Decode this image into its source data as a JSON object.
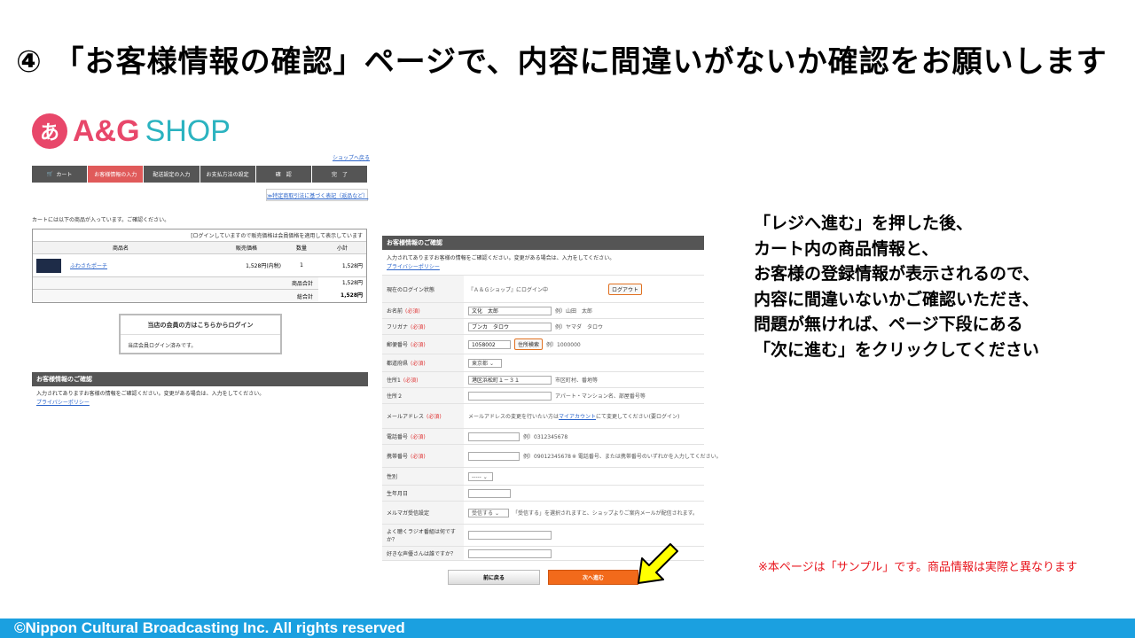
{
  "title": "④ 「お客様情報の確認」ページで、内容に間違いがないか確認をお願いします",
  "logo": {
    "mark": "あ",
    "ag": "A&G",
    "shop": "SHOP"
  },
  "shop_back_link": "ショップへ戻る",
  "steps": [
    "カート",
    "お客様情報の入力",
    "配送設定の入力",
    "お支払方法の設定",
    "確　認",
    "完　了"
  ],
  "tokutei_link": "≫特定商取引法に基づく表記（返品など）",
  "cart": {
    "intro": "カートには以下の商品が入っています。ご確認ください。",
    "notice": "[ログインしていますので販売価格は会員価格を適用して表示しています",
    "headers": [
      "商品名",
      "販売価格",
      "数量",
      "小計"
    ],
    "item": {
      "name": "ふわさたポーチ",
      "price": "1,528円(内税)",
      "qty": "1",
      "subtotal": "1,528円"
    },
    "goods_total_label": "商品合計",
    "goods_total": "1,528円",
    "grand_total_label": "総合計",
    "grand_total": "1,528円"
  },
  "member_box": {
    "title": "当店の会員の方はこちらからログイン",
    "status": "当店会員ログイン済みです。"
  },
  "left_confirm": {
    "heading": "お客様情報のご確認",
    "desc": "入力されてありますお客様の情報をご確認ください。変更がある場合は、入力をしてください。",
    "privacy": "プライバシーポリシー"
  },
  "form": {
    "heading": "お客様情報のご確認",
    "desc": "入力されてありますお客様の情報をご確認ください。変更がある場合は、入力をしてください。",
    "privacy": "プライバシーポリシー",
    "required_label": "(必須)",
    "login_state_label": "現在のログイン状態",
    "login_state_text": "『Ａ＆Ｇショップ』にログイン中",
    "logout_button": "ログアウト",
    "name_label": "お名前",
    "name_value": "文化　太郎",
    "name_example": "例）山田　太郎",
    "kana_label": "フリガナ",
    "kana_value": "ブンカ　タロウ",
    "kana_example": "例）ヤマダ　タロウ",
    "zip_label": "郵便番号",
    "zip_value": "1058002",
    "zip_button": "住所検索",
    "zip_example": "例）1000000",
    "pref_label": "都道府県",
    "pref_value": "東京都",
    "addr1_label": "住所1",
    "addr1_value": "港区浜松町１－３１",
    "addr1_hint": "市区町村、番地等",
    "addr2_label": "住所２",
    "addr2_hint": "アパート・マンション名、部屋番号等",
    "mail_label": "メールアドレス",
    "mail_text_pre": "メールアドレスの変更を行いたい方は",
    "mail_link": "マイアカウント",
    "mail_text_post": "にて変更してください(要ログイン)",
    "tel_label": "電話番号",
    "tel_example": "例）0312345678",
    "mobile_label": "携帯番号",
    "mobile_example": "例）09012345678",
    "mobile_note": "※ 電話番号、または携帯番号のいずれかを入力してください。",
    "gender_label": "性別",
    "gender_value": "-----",
    "birthday_label": "生年月日",
    "magazine_label": "メルマガ受信設定",
    "magazine_value": "受信する",
    "magazine_note": "「受信する」を選択されますと、ショップよりご案内メールが配信されます。",
    "radio_label": "よく聴くラジオ番組は何ですか？",
    "seiyu_label": "好きな声優さんは誰ですか？"
  },
  "buttons": {
    "back": "前に戻る",
    "next": "次へ進む"
  },
  "instructions": [
    "「レジへ進む」を押した後、",
    "カート内の商品情報と、",
    "お客様の登録情報が表示されるので、",
    "内容に間違いないかご確認いただき、",
    "問題が無ければ、ページ下段にある",
    "「次に進む」をクリックしてください"
  ],
  "sample_note": "※本ページは「サンプル」です。商品情報は実際と異なります",
  "footer": "©Nippon Cultural Broadcasting Inc. All rights reserved",
  "colors": {
    "accent_red": "#e8476a",
    "accent_teal": "#2bb3c0",
    "next_orange": "#f26a1b",
    "footer_blue": "#1ba0e0",
    "arrow_yellow": "#ffff00"
  }
}
